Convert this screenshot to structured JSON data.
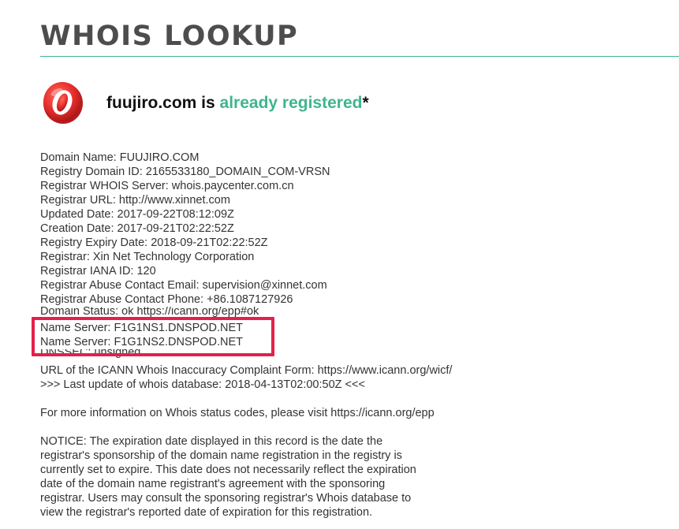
{
  "page": {
    "title": "WHOIS LOOKUP"
  },
  "status": {
    "domain": "fuujiro.com",
    "connector": " is ",
    "state": "already registered",
    "suffix": "*",
    "icon": "registered-badge-icon",
    "accent_color": "#3fb58e",
    "badge_color": "#e52b2b"
  },
  "record": {
    "lines_top": [
      "Domain Name: FUUJIRO.COM",
      "Registry Domain ID: 2165533180_DOMAIN_COM-VRSN",
      "Registrar WHOIS Server: whois.paycenter.com.cn",
      "Registrar URL: http://www.xinnet.com",
      "Updated Date: 2017-09-22T08:12:09Z",
      "Creation Date: 2017-09-21T02:22:52Z",
      "Registry Expiry Date: 2018-09-21T02:22:52Z",
      "Registrar: Xin Net Technology Corporation",
      "Registrar IANA ID: 120",
      "Registrar Abuse Contact Email: supervision@xinnet.com",
      "Registrar Abuse Contact Phone: +86.1087127926"
    ],
    "domain_status": "Domain Status: ok https://icann.org/epp#ok",
    "name_servers": [
      "Name Server: F1G1NS1.DNSPOD.NET",
      "Name Server: F1G1NS2.DNSPOD.NET"
    ],
    "dnssec": "DNSSEC: unsigned",
    "lines_after": [
      "URL of the ICANN Whois Inaccuracy Complaint Form: https://www.icann.org/wicf/",
      ">>> Last update of whois database: 2018-04-13T02:00:50Z <<<"
    ],
    "status_info": "For more information on Whois status codes, please visit https://icann.org/epp",
    "notice": [
      "NOTICE: The expiration date displayed in this record is the date the",
      "registrar's sponsorship of the domain name registration in the registry is",
      "currently set to expire. This date does not necessarily reflect the expiration",
      "date of the domain name registrant's agreement with the sponsoring",
      "registrar. Users may consult the sponsoring registrar's Whois database to",
      "view the registrar's reported date of expiration for this registration."
    ],
    "highlight_color": "#e4204a"
  }
}
